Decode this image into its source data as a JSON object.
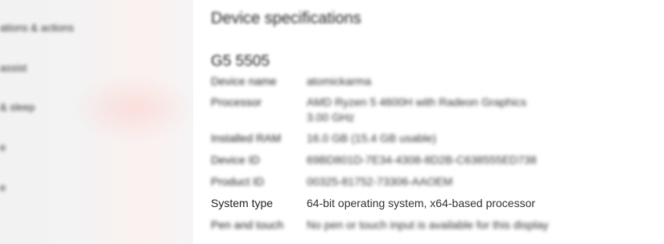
{
  "sidebar": {
    "items": [
      {
        "label": "ations & actions"
      },
      {
        "label": "assist"
      },
      {
        "label": "& sleep"
      },
      {
        "label": "e"
      },
      {
        "label": "e"
      }
    ]
  },
  "main": {
    "section_title": "Device specifications",
    "device_model": "G5 5505",
    "specs": [
      {
        "label": "Device name",
        "value": "atomickarma"
      },
      {
        "label": "Processor",
        "value": "AMD Ryzen 5 4600H with Radeon Graphics",
        "value_line2": "3.00 GHz"
      },
      {
        "label": "Installed RAM",
        "value": "16.0 GB (15.4 GB usable)"
      },
      {
        "label": "Device ID",
        "value": "69BD801D-7E34-4308-8D2B-C638555ED738"
      },
      {
        "label": "Product ID",
        "value": "00325-81752-73306-AAOEM"
      },
      {
        "label": "System type",
        "value": "64-bit operating system, x64-based processor"
      },
      {
        "label": "Pen and touch",
        "value": "No pen or touch input is available for this display"
      }
    ]
  }
}
